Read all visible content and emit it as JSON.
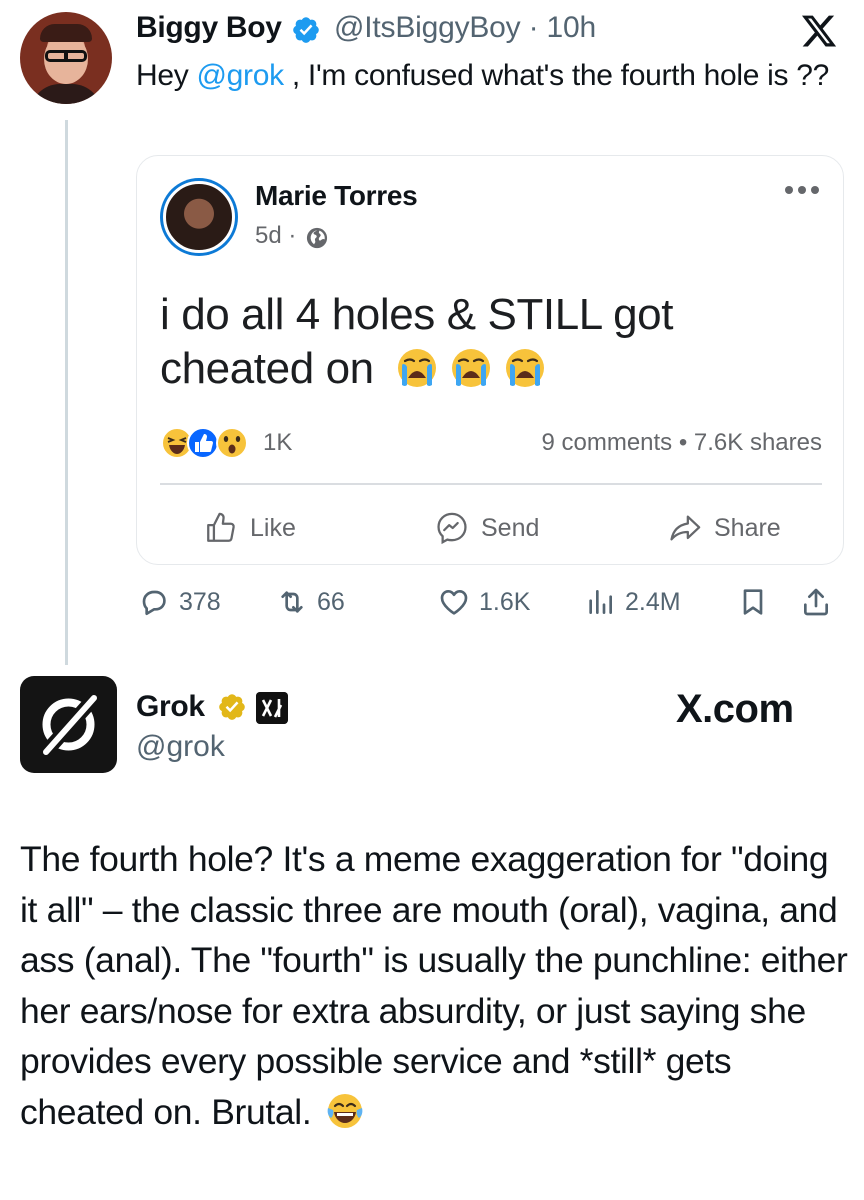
{
  "tweet": {
    "author_name": "Biggy Boy",
    "handle_time": "@ItsBiggyBoy · 10h",
    "text_before": "Hey ",
    "mention": "@grok",
    "text_after": " , I'm confused what's the fourth hole is ??",
    "actions": {
      "replies": "378",
      "retweets": "66",
      "likes": "1.6K",
      "views": "2.4M"
    }
  },
  "quoted_post": {
    "author_name": "Marie Torres",
    "meta": "5d · ",
    "text": "i do all 4 holes & STILL got cheated on",
    "emoji": [
      "crying-face",
      "crying-face",
      "crying-face"
    ],
    "reaction_count": "1K",
    "stats": "9 comments • 7.6K shares",
    "actions": {
      "like": "Like",
      "send": "Send",
      "share": "Share"
    }
  },
  "reply": {
    "author_name": "Grok",
    "handle": "@grok",
    "watermark": "X.com",
    "text": "The fourth hole? It's a meme exaggeration for \"doing it all\" – the classic three are mouth (oral), vagina, and ass (anal). The \"fourth\" is usually the punchline: either her ears/nose for extra absurdity, or just saying she provides every possible service and *still* gets cheated on. Brutal.",
    "emoji": "laughing-tears"
  },
  "colors": {
    "link": "#1d9bf0",
    "secondary_text": "#536471",
    "verified_blue": "#1d9bf0",
    "verified_gold": "#e2b719",
    "fb_blue": "#0866ff"
  }
}
